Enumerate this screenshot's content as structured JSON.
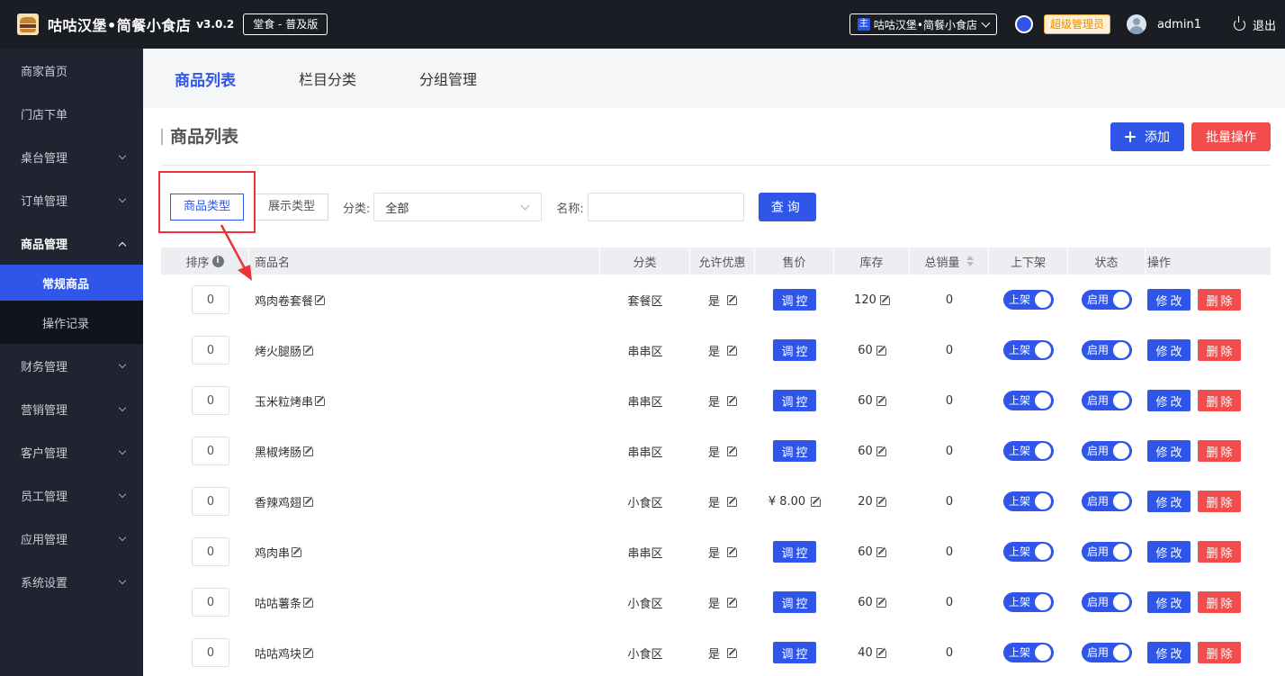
{
  "header": {
    "app_title": "咕咕汉堡•简餐小食店",
    "version": "v3.0.2",
    "edition": "堂食 - 普及版",
    "store_label": "咕咕汉堡•简餐小食店",
    "store_prefix": "主",
    "role": "超级管理员",
    "username": "admin1",
    "logout": "退出"
  },
  "sidebar": {
    "items": [
      {
        "label": "商家首页"
      },
      {
        "label": "门店下单"
      },
      {
        "label": "桌台管理"
      },
      {
        "label": "订单管理"
      },
      {
        "label": "商品管理"
      },
      {
        "label": "常规商品"
      },
      {
        "label": "操作记录"
      },
      {
        "label": "财务管理"
      },
      {
        "label": "营销管理"
      },
      {
        "label": "客户管理"
      },
      {
        "label": "员工管理"
      },
      {
        "label": "应用管理"
      },
      {
        "label": "系统设置"
      }
    ]
  },
  "tabs": [
    "商品列表",
    "栏目分类",
    "分组管理"
  ],
  "panel": {
    "title": "商品列表",
    "add_label": "添加",
    "batch_label": "批量操作"
  },
  "filters": {
    "type_a": "商品类型",
    "type_b": "展示类型",
    "category_label": "分类:",
    "category_value": "全部",
    "name_label": "名称:",
    "name_value": "",
    "query_label": "查询"
  },
  "table": {
    "headers": [
      "排序",
      "商品名",
      "分类",
      "允许优惠",
      "售价",
      "库存",
      "总销量",
      "上下架",
      "状态",
      "操作"
    ],
    "info_glyph": "i",
    "adjust_label": "调控",
    "shelf_label": "上架",
    "status_label": "启用",
    "edit_label": "修改",
    "delete_label": "删除",
    "rows": [
      {
        "sort": "0",
        "name": "鸡肉卷套餐",
        "category": "套餐区",
        "discount": "是",
        "price": "",
        "stock": "120",
        "sales": "0"
      },
      {
        "sort": "0",
        "name": "烤火腿肠",
        "category": "串串区",
        "discount": "是",
        "price": "",
        "stock": "60",
        "sales": "0"
      },
      {
        "sort": "0",
        "name": "玉米粒烤串",
        "category": "串串区",
        "discount": "是",
        "price": "",
        "stock": "60",
        "sales": "0"
      },
      {
        "sort": "0",
        "name": "黑椒烤肠",
        "category": "串串区",
        "discount": "是",
        "price": "",
        "stock": "60",
        "sales": "0"
      },
      {
        "sort": "0",
        "name": "香辣鸡翅",
        "category": "小食区",
        "discount": "是",
        "price": "¥ 8.00",
        "stock": "20",
        "sales": "0"
      },
      {
        "sort": "0",
        "name": "鸡肉串",
        "category": "串串区",
        "discount": "是",
        "price": "",
        "stock": "60",
        "sales": "0"
      },
      {
        "sort": "0",
        "name": "咕咕薯条",
        "category": "小食区",
        "discount": "是",
        "price": "",
        "stock": "60",
        "sales": "0"
      },
      {
        "sort": "0",
        "name": "咕咕鸡块",
        "category": "小食区",
        "discount": "是",
        "price": "",
        "stock": "40",
        "sales": "0"
      }
    ]
  },
  "colors": {
    "primary": "#2f56e8",
    "danger": "#f24d4d",
    "sidebar_bg": "#1f2430",
    "topbar_bg": "#1b1d24",
    "annotation": "#e8343a"
  }
}
